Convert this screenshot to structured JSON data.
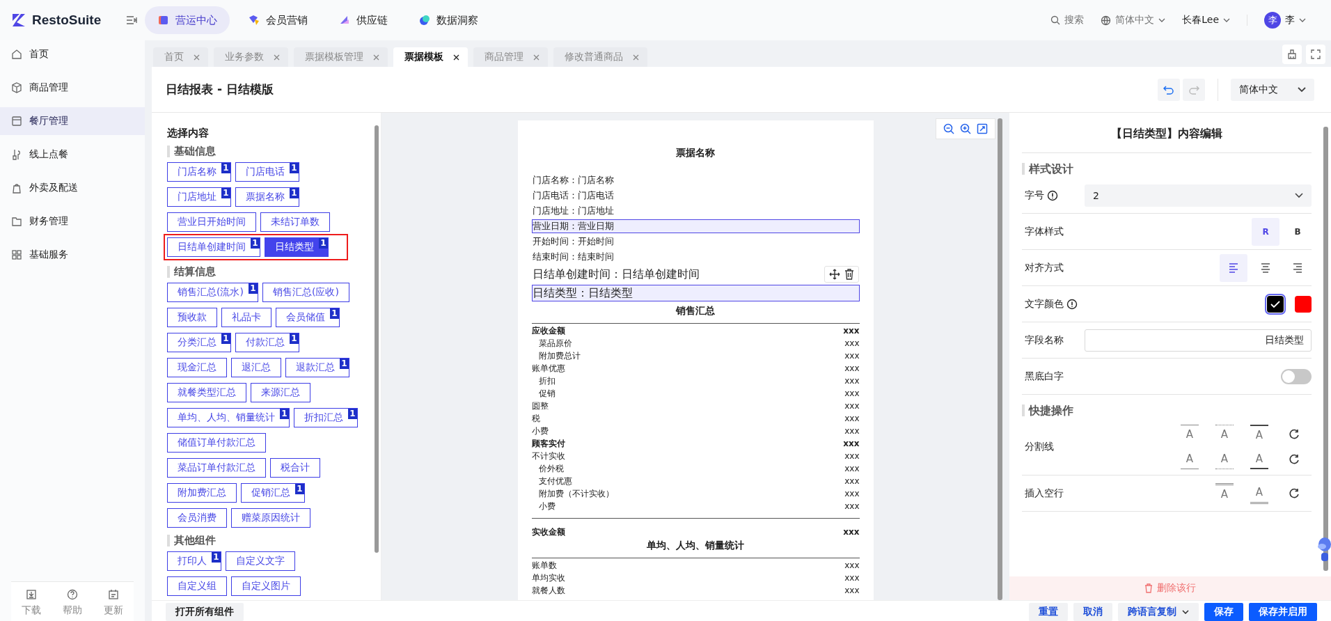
{
  "app": {
    "logo": "RestoSuite"
  },
  "top_nav": [
    {
      "label": "营运中心",
      "selected": true
    },
    {
      "label": "会员营销",
      "selected": false
    },
    {
      "label": "供应链",
      "selected": false
    },
    {
      "label": "数据洞察",
      "selected": false
    }
  ],
  "header_tools": {
    "search": "搜索",
    "language": "简体中文",
    "store": "长春Lee",
    "avatar": "李",
    "user": "李"
  },
  "sidebar": {
    "items": [
      {
        "label": "首页",
        "selected": false
      },
      {
        "label": "商品管理",
        "selected": false
      },
      {
        "label": "餐厅管理",
        "selected": true
      },
      {
        "label": "线上点餐",
        "selected": false
      },
      {
        "label": "外卖及配送",
        "selected": false
      },
      {
        "label": "财务管理",
        "selected": false
      },
      {
        "label": "基础服务",
        "selected": false
      }
    ],
    "footer": [
      {
        "label": "下载"
      },
      {
        "label": "帮助"
      },
      {
        "label": "更新"
      }
    ]
  },
  "tabs": [
    {
      "label": "首页",
      "selected": false
    },
    {
      "label": "业务参数",
      "selected": false
    },
    {
      "label": "票据模板管理",
      "selected": false
    },
    {
      "label": "票据模板",
      "selected": true
    },
    {
      "label": "商品管理",
      "selected": false
    },
    {
      "label": "修改普通商品",
      "selected": false
    }
  ],
  "page": {
    "title": "日结报表 - 日结模版",
    "language": "简体中文"
  },
  "components": {
    "title": "选择内容",
    "groups": [
      {
        "title": "基础信息",
        "rows": [
          {
            "highlighted": false,
            "items": [
              {
                "label": "门店名称",
                "count": "1",
                "selected": false
              },
              {
                "label": "门店电话",
                "count": "1",
                "selected": false
              }
            ]
          },
          {
            "highlighted": false,
            "items": [
              {
                "label": "门店地址",
                "count": "1",
                "selected": false
              },
              {
                "label": "票据名称",
                "count": "1",
                "selected": false
              }
            ]
          },
          {
            "highlighted": false,
            "items": [
              {
                "label": "营业日开始时间",
                "selected": false
              },
              {
                "label": "未结订单数",
                "selected": false
              }
            ]
          },
          {
            "highlighted": true,
            "items": [
              {
                "label": "日结单创建时间",
                "count": "1",
                "selected": false
              },
              {
                "label": "日结类型",
                "count": "1",
                "selected": true
              }
            ]
          }
        ]
      },
      {
        "title": "结算信息",
        "rows": [
          {
            "highlighted": false,
            "items": [
              {
                "label": "销售汇总(流水)",
                "count": "1",
                "selected": false
              },
              {
                "label": "销售汇总(应收)",
                "selected": false
              }
            ]
          },
          {
            "highlighted": false,
            "items": [
              {
                "label": "预收款",
                "selected": false
              },
              {
                "label": "礼品卡",
                "selected": false
              },
              {
                "label": "会员储值",
                "count": "1",
                "selected": false
              }
            ]
          },
          {
            "highlighted": false,
            "items": [
              {
                "label": "分类汇总",
                "count": "1",
                "selected": false
              },
              {
                "label": "付款汇总",
                "count": "1",
                "selected": false
              }
            ]
          },
          {
            "highlighted": false,
            "items": [
              {
                "label": "现金汇总",
                "selected": false
              },
              {
                "label": "退汇总",
                "selected": false
              },
              {
                "label": "退款汇总",
                "count": "1",
                "selected": false
              }
            ]
          },
          {
            "highlighted": false,
            "items": [
              {
                "label": "就餐类型汇总",
                "selected": false
              },
              {
                "label": "来源汇总",
                "selected": false
              }
            ]
          },
          {
            "highlighted": false,
            "items": [
              {
                "label": "单均、人均、销量统计",
                "count": "1",
                "selected": false
              },
              {
                "label": "折扣汇总",
                "count": "1",
                "selected": false
              }
            ]
          },
          {
            "highlighted": false,
            "items": [
              {
                "label": "储值订单付款汇总",
                "selected": false
              }
            ]
          },
          {
            "highlighted": false,
            "items": [
              {
                "label": "菜品订单付款汇总",
                "selected": false
              },
              {
                "label": "税合计",
                "selected": false
              }
            ]
          },
          {
            "highlighted": false,
            "items": [
              {
                "label": "附加费汇总",
                "selected": false
              },
              {
                "label": "促销汇总",
                "count": "1",
                "selected": false
              }
            ]
          },
          {
            "highlighted": false,
            "items": [
              {
                "label": "会员消费",
                "selected": false
              },
              {
                "label": "赠菜原因统计",
                "selected": false
              }
            ]
          }
        ]
      },
      {
        "title": "其他组件",
        "rows": [
          {
            "highlighted": false,
            "items": [
              {
                "label": "打印人",
                "count": "1",
                "selected": false
              },
              {
                "label": "自定义文字",
                "selected": false
              }
            ]
          },
          {
            "highlighted": false,
            "items": [
              {
                "label": "自定义组",
                "selected": false
              },
              {
                "label": "自定义图片",
                "selected": false
              }
            ]
          }
        ]
      }
    ],
    "open_all": "打开所有组件"
  },
  "preview": {
    "items": [
      {
        "kind": "title",
        "text": "票据名称"
      },
      {
        "kind": "field",
        "text": "门店名称：门店名称",
        "large": false,
        "highlighted": false
      },
      {
        "kind": "field",
        "text": "门店电话：门店电话",
        "large": false,
        "highlighted": false
      },
      {
        "kind": "field",
        "text": "门店地址：门店地址",
        "large": false,
        "highlighted": false
      },
      {
        "kind": "field",
        "text": "营业日期：营业日期",
        "large": false,
        "highlighted": true
      },
      {
        "kind": "field",
        "text": "开始时间：开始时间",
        "large": false,
        "highlighted": false
      },
      {
        "kind": "field",
        "text": "结束时间：结束时间",
        "large": false,
        "highlighted": false
      },
      {
        "kind": "field",
        "text": "日结单创建时间：日结单创建时间",
        "large": true,
        "highlighted": false,
        "hover_tools": true
      },
      {
        "kind": "field",
        "text": "日结类型：日结类型",
        "large": true,
        "highlighted": true
      },
      {
        "kind": "title",
        "text": "销售汇总"
      },
      {
        "kind": "rule"
      },
      {
        "kind": "row",
        "label": "应收金额",
        "value": "xxx",
        "bold": true,
        "indent": false
      },
      {
        "kind": "row",
        "label": "菜品原价",
        "value": "xxx",
        "bold": false,
        "indent": true
      },
      {
        "kind": "row",
        "label": "附加费总计",
        "value": "xxx",
        "bold": false,
        "indent": true
      },
      {
        "kind": "row",
        "label": "账单优惠",
        "value": "xxx",
        "bold": false,
        "indent": false
      },
      {
        "kind": "row",
        "label": "折扣",
        "value": "xxx",
        "bold": false,
        "indent": true
      },
      {
        "kind": "row",
        "label": "促销",
        "value": "xxx",
        "bold": false,
        "indent": true
      },
      {
        "kind": "row",
        "label": "圆整",
        "value": "xxx",
        "bold": false,
        "indent": false
      },
      {
        "kind": "row",
        "label": "税",
        "value": "xxx",
        "bold": false,
        "indent": false
      },
      {
        "kind": "row",
        "label": "小费",
        "value": "xxx",
        "bold": false,
        "indent": false
      },
      {
        "kind": "row",
        "label": "顾客实付",
        "value": "xxx",
        "bold": true,
        "indent": false
      },
      {
        "kind": "row",
        "label": "不计实收",
        "value": "xxx",
        "bold": false,
        "indent": false
      },
      {
        "kind": "row",
        "label": "价外税",
        "value": "xxx",
        "bold": false,
        "indent": true
      },
      {
        "kind": "row",
        "label": "支付优惠",
        "value": "xxx",
        "bold": false,
        "indent": true
      },
      {
        "kind": "row",
        "label": "附加费（不计实收）",
        "value": "xxx",
        "bold": false,
        "indent": true
      },
      {
        "kind": "row",
        "label": "小费",
        "value": "xxx",
        "bold": false,
        "indent": true
      },
      {
        "kind": "rule"
      },
      {
        "kind": "row",
        "label": "实收金额",
        "value": "xxx",
        "bold": true,
        "indent": false
      },
      {
        "kind": "title",
        "text": "单均、人均、销量统计"
      },
      {
        "kind": "rule"
      },
      {
        "kind": "row",
        "label": "账单数",
        "value": "xxx",
        "bold": false,
        "indent": false
      },
      {
        "kind": "row",
        "label": "单均实收",
        "value": "xxx",
        "bold": false,
        "indent": false
      },
      {
        "kind": "row",
        "label": "就餐人数",
        "value": "xxx",
        "bold": false,
        "indent": false
      }
    ]
  },
  "editor": {
    "title": "【日结类型】内容编辑",
    "sections": [
      {
        "title": "样式设计",
        "rows": [
          {
            "kind": "select",
            "label": "字号",
            "info": true,
            "value": "2"
          },
          {
            "kind": "options",
            "label": "字体样式",
            "options": [
              {
                "label": "R",
                "selected": true
              },
              {
                "label": "B",
                "selected": false
              }
            ]
          },
          {
            "kind": "align",
            "label": "对齐方式",
            "options": [
              {
                "selected": true
              },
              {
                "selected": false
              },
              {
                "selected": false
              }
            ]
          },
          {
            "kind": "colors",
            "label": "文字颜色",
            "info": true,
            "options": [
              {
                "color": "#000000",
                "selected": true
              },
              {
                "color": "#ff0000",
                "selected": false
              }
            ]
          },
          {
            "kind": "input",
            "label": "字段名称",
            "value": "日结类型"
          },
          {
            "kind": "toggle",
            "label": "黑底白字",
            "on": false
          }
        ]
      },
      {
        "title": "快捷操作",
        "rows": [
          {
            "kind": "tools",
            "label": "分割线",
            "buttons": [
              {
                "kind": "line-above",
                "text": "A"
              },
              {
                "kind": "dotted-above",
                "text": "A"
              },
              {
                "kind": "thick-above",
                "text": "A"
              },
              {
                "kind": "reset"
              },
              {
                "kind": "line-below",
                "text": "A"
              },
              {
                "kind": "dotted-below",
                "text": "A"
              },
              {
                "kind": "thick-below",
                "text": "A"
              },
              {
                "kind": "reset"
              }
            ]
          },
          {
            "kind": "tools",
            "label": "插入空行",
            "buttons": [
              {
                "kind": "blank-above",
                "text": "A"
              },
              {
                "kind": "blank-below",
                "text": "A"
              },
              {
                "kind": "reset"
              }
            ]
          }
        ]
      }
    ],
    "delete": "删除该行"
  },
  "footer_buttons": [
    {
      "label": "重置",
      "kind": "plain"
    },
    {
      "label": "取消",
      "kind": "plain"
    },
    {
      "label": "跨语言复制",
      "kind": "dropdown"
    },
    {
      "label": "保存",
      "kind": "primary"
    },
    {
      "label": "保存并启用",
      "kind": "primary"
    }
  ]
}
